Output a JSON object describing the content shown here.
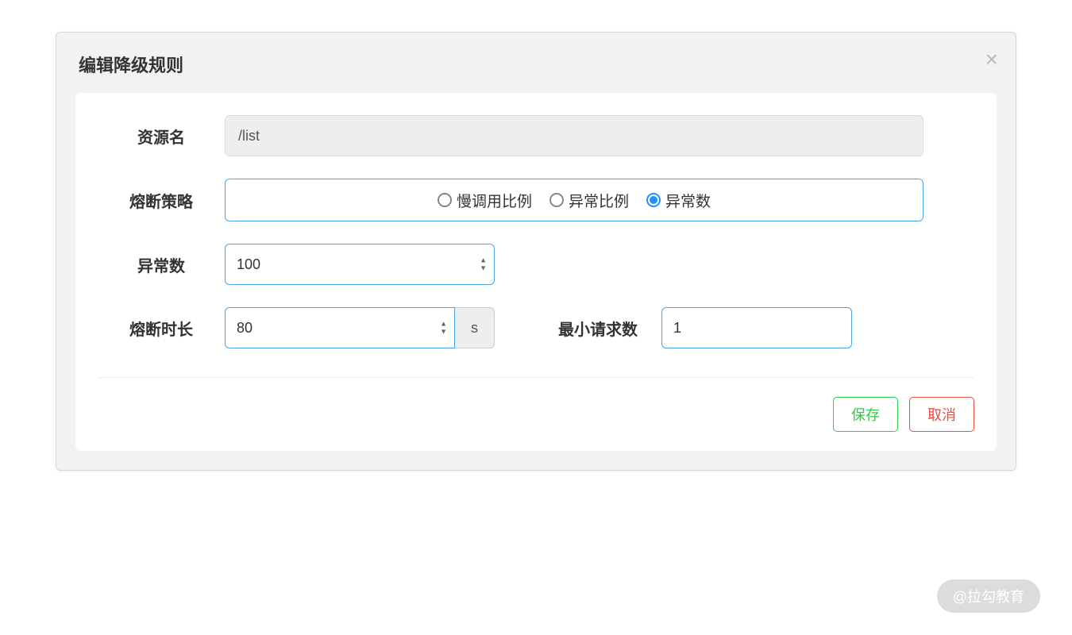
{
  "modal": {
    "title": "编辑降级规则",
    "close_label": "×"
  },
  "form": {
    "resource": {
      "label": "资源名",
      "value": "/list"
    },
    "strategy": {
      "label": "熔断策略",
      "options": [
        {
          "label": "慢调用比例",
          "selected": false
        },
        {
          "label": "异常比例",
          "selected": false
        },
        {
          "label": "异常数",
          "selected": true
        }
      ]
    },
    "exception_count": {
      "label": "异常数",
      "value": "100"
    },
    "break_duration": {
      "label": "熔断时长",
      "value": "80",
      "unit": "s"
    },
    "min_requests": {
      "label": "最小请求数",
      "value": "1"
    }
  },
  "footer": {
    "save_label": "保存",
    "cancel_label": "取消"
  },
  "watermark": "@拉勾教育"
}
